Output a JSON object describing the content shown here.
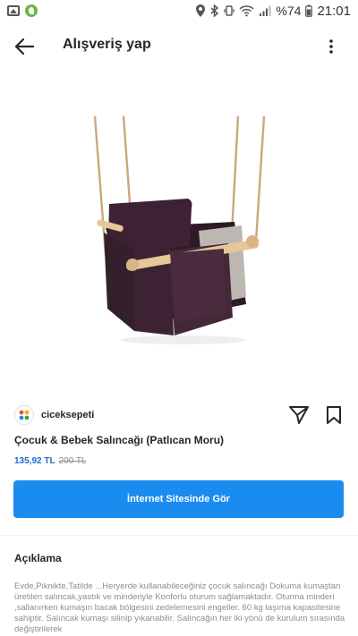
{
  "status_bar": {
    "battery": "%74",
    "time": "21:01"
  },
  "header": {
    "title": "Alışveriş yap"
  },
  "product": {
    "merchant": "ciceksepeti",
    "title": "Çocuk & Bebek Salıncağı (Patlıcan Moru)",
    "price_current": "135,92 TL",
    "price_old": "200 TL",
    "cta_label": "İnternet Sitesinde Gör",
    "colors": {
      "accent": "#1a8cf0",
      "price": "#1a6bc9",
      "fabric": "#3d2233"
    }
  },
  "description": {
    "heading": "Açıklama",
    "text": "Evde,Piknikte,Tatilde ...Heryerde kullanabileceğiniz çocuk salıncağı Dokuma kumaştan üretilen salıncak,yastık ve minderiyle Konforlu oturum sağlamaktadır. Oturma minderi ,sallanırken kumaşın bacak bölgesini zedelemesini engeller. 60 kg taşıma kapasitesine sahiptir. Salıncak kumaşı silinip yıkanabilir. Salıncağın her iki yönü de kurulum sırasında değiştirilerek"
  },
  "icons": {
    "back": "arrow-left-icon",
    "more": "more-vertical-icon",
    "share": "send-icon",
    "save": "bookmark-icon"
  }
}
